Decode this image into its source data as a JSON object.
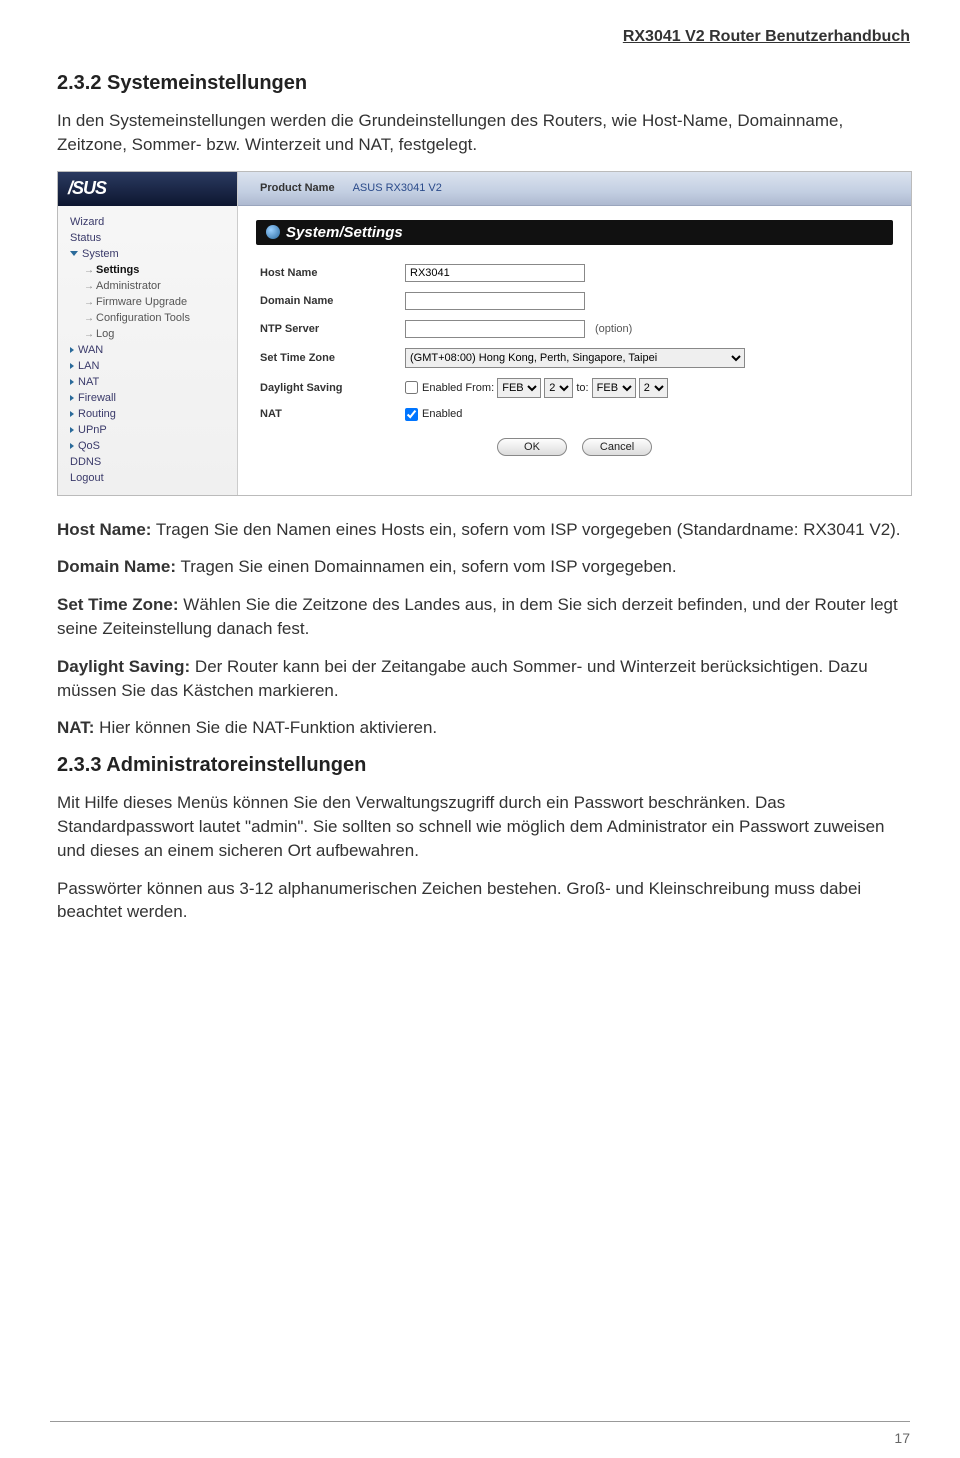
{
  "doc": {
    "header": "RX3041 V2 Router Benutzerhandbuch",
    "page_number": "17",
    "h_232": "2.3.2 Systemeinstellungen",
    "p_232": "In den Systemeinstellungen werden die Grundeinstellungen des Routers, wie Host-Name, Domainname, Zeitzone, Sommer- bzw. Winterzeit und NAT, festgelegt.",
    "hostname_b": "Host Name:",
    "hostname_t": " Tragen Sie den Namen eines Hosts ein, sofern vom ISP vorgegeben (Standardname: RX3041 V2).",
    "domain_b": "Domain Name:",
    "domain_t": " Tragen Sie einen Domainnamen ein, sofern vom ISP vorgegeben.",
    "tz_b": "Set Time Zone:",
    "tz_t": " Wählen Sie die Zeitzone des Landes aus, in dem Sie sich derzeit befinden, und der Router legt seine Zeiteinstellung danach fest.",
    "ds_b": "Daylight Saving:",
    "ds_t": " Der Router kann bei der Zeitangabe auch Sommer- und Winterzeit berücksichtigen. Dazu müssen Sie das Kästchen markieren.",
    "nat_b": "NAT:",
    "nat_t": " Hier können Sie die NAT-Funktion aktivieren.",
    "h_233": "2.3.3 Administratoreinstellungen",
    "p_233a": "Mit Hilfe dieses Menüs können Sie den Verwaltungszugriff durch ein Passwort beschränken. Das Standardpasswort lautet \"admin\". Sie sollten so schnell wie möglich dem Administrator ein Passwort zuweisen und dieses an einem sicheren Ort aufbewahren.",
    "p_233b": "Passwörter können aus 3-12 alphanumerischen Zeichen bestehen. Groß- und Kleinschreibung muss dabei beachtet werden."
  },
  "shot": {
    "logo": "/SUS",
    "product_label": "Product Name",
    "product_value": "ASUS RX3041 V2",
    "panel_title": "System/Settings",
    "nav": {
      "wizard": "Wizard",
      "status": "Status",
      "system": "System",
      "settings": "Settings",
      "admin": "Administrator",
      "fw": "Firmware Upgrade",
      "cfg": "Configuration Tools",
      "log": "Log",
      "wan": "WAN",
      "lan": "LAN",
      "nat": "NAT",
      "firewall": "Firewall",
      "routing": "Routing",
      "upnp": "UPnP",
      "qos": "QoS",
      "ddns": "DDNS",
      "logout": "Logout"
    },
    "form": {
      "hostname_label": "Host Name",
      "hostname_value": "RX3041",
      "domain_label": "Domain Name",
      "domain_value": "",
      "ntp_label": "NTP Server",
      "ntp_value": "",
      "ntp_note": "(option)",
      "tz_label": "Set Time Zone",
      "tz_value": "(GMT+08:00) Hong Kong, Perth, Singapore, Taipei",
      "ds_label": "Daylight Saving",
      "ds_enabled_text": "Enabled  From:",
      "ds_to": "to:",
      "ds_from_month": "FEB",
      "ds_from_day": "2",
      "ds_to_month": "FEB",
      "ds_to_day": "2",
      "nat_label": "NAT",
      "nat_enabled_text": "Enabled",
      "ok": "OK",
      "cancel": "Cancel"
    }
  }
}
